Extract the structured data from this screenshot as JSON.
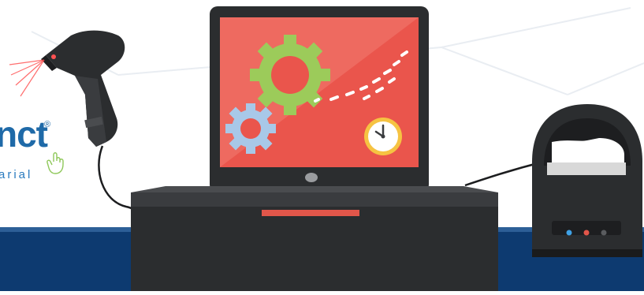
{
  "logo": {
    "text": "nct",
    "registered_mark": "®",
    "tagline": "arial"
  },
  "icons": [
    "barcode-scanner-icon",
    "laser-beam-icon",
    "pos-monitor-icon",
    "gear-icon",
    "clock-icon",
    "receipt-printer-icon",
    "hand-pointer-icon"
  ],
  "colors": {
    "background": "#ffffff",
    "floor_band": "#0d3a70",
    "device_dark": "#2b2d2f",
    "screen_red": "#ea554c",
    "gear_green": "#9ccb5a",
    "gear_blue": "#a8c8e8",
    "clock_yellow": "#f6c342",
    "accent_red": "#e1564a",
    "logo_blue": "#1f6aa8"
  }
}
